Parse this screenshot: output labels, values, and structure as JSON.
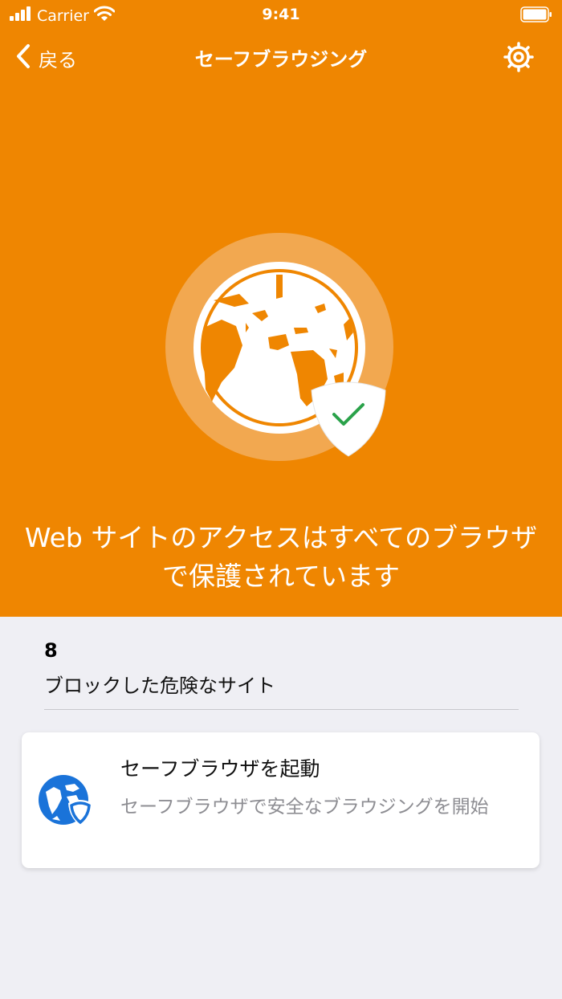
{
  "status_bar": {
    "carrier": "Carrier",
    "time": "9:41"
  },
  "nav": {
    "back_label": "戻る",
    "title": "セーフブラウジング"
  },
  "hero": {
    "headline": "Web サイトのアクセスはすべてのブラウザで保護されています"
  },
  "stats": {
    "blocked_count": "8",
    "blocked_label": "ブロックした危険なサイト"
  },
  "card": {
    "title": "セーフブラウザを起動",
    "description": "セーフブラウザで安全なブラウジングを開始"
  },
  "colors": {
    "accent": "#ef8601",
    "background": "#efeff4",
    "check": "#2aa24a",
    "icon_blue": "#1a73d9"
  },
  "icons": [
    "signal-icon",
    "wifi-icon",
    "battery-icon",
    "back-chevron-icon",
    "gear-icon",
    "globe-icon",
    "shield-check-icon",
    "safe-browser-icon"
  ]
}
